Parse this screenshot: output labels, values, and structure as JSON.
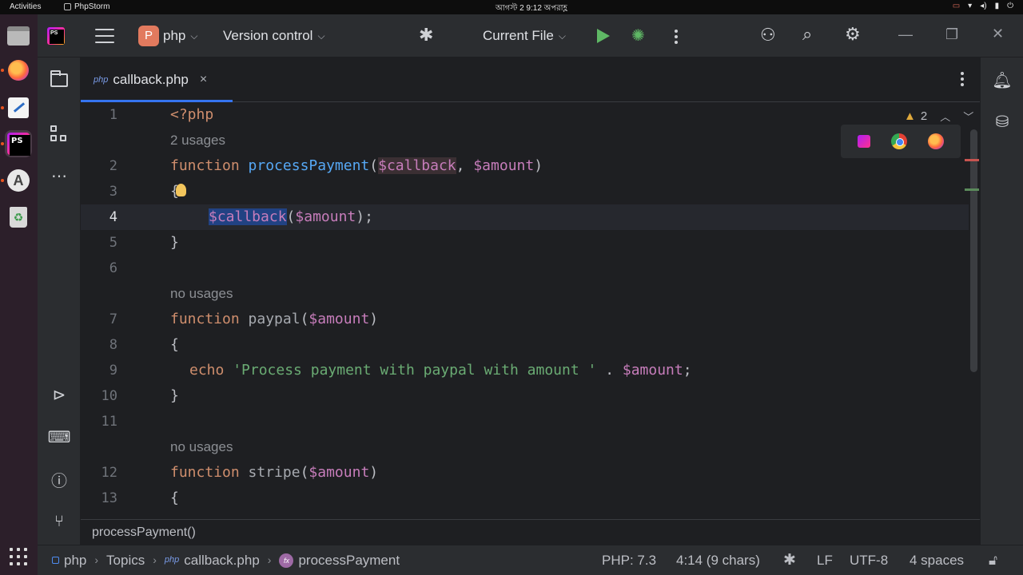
{
  "system_bar": {
    "activities": "Activities",
    "app_name": "PhpStorm",
    "clock": "আগস্ট 2  9:12 অপরাহ্ণ"
  },
  "toolbar": {
    "project_badge": "P",
    "project_name": "php",
    "vcs_label": "Version control",
    "run_config": "Current File"
  },
  "tabs": [
    {
      "lang_tag": "php",
      "label": "callback.php",
      "close": "×"
    }
  ],
  "editor": {
    "warnings_count": "2",
    "lines": [
      {
        "n": "1"
      },
      {
        "hint": "2 usages"
      },
      {
        "n": "2"
      },
      {
        "n": "3"
      },
      {
        "n": "4"
      },
      {
        "n": "5"
      },
      {
        "n": "6"
      },
      {
        "hint": "no usages"
      },
      {
        "n": "7"
      },
      {
        "n": "8"
      },
      {
        "n": "9"
      },
      {
        "n": "10"
      },
      {
        "n": "11"
      },
      {
        "hint": "no usages"
      },
      {
        "n": "12"
      },
      {
        "n": "13"
      }
    ],
    "code": {
      "l1": "<?php",
      "l2_kw": "function",
      "l2_fn": "processPayment",
      "l2_p1": "$callback",
      "l2_p2": "$amount",
      "l3": "{",
      "l4_sel": "$callback",
      "l4_arg": "$amount",
      "l5": "}",
      "l7_kw": "function",
      "l7_fn": "paypal",
      "l7_p": "$amount",
      "l8": "{",
      "l9_kw": "echo",
      "l9_str": "'Process payment with paypal with amount '",
      "l9_op": " . ",
      "l9_var": "$amount",
      "l10": "}",
      "l12_kw": "function",
      "l12_fn": "stripe",
      "l12_p": "$amount",
      "l13": "{"
    }
  },
  "breadcrumb_below": "processPayment()",
  "statusbar": {
    "module": "php",
    "topics": "Topics",
    "file_tag": "php",
    "file": "callback.php",
    "fn_badge": "fx",
    "function": "processPayment",
    "php_version": "PHP: 7.3",
    "caret": "4:14 (9 chars)",
    "line_sep": "LF",
    "encoding": "UTF-8",
    "indent": "4 spaces"
  },
  "colors": {
    "accent": "#3574f0",
    "keyword": "#cf8e6d",
    "function": "#56a8f5",
    "variable": "#c77dbb",
    "string": "#6aab73"
  },
  "icons": [
    "hamburger-icon",
    "debug-bug-icon",
    "run-icon",
    "debug-icon",
    "more-icon",
    "add-user-icon",
    "search-icon",
    "settings-icon",
    "minimize-icon",
    "restore-icon",
    "close-icon",
    "folder-icon",
    "structure-icon",
    "more-tools-icon",
    "services-icon",
    "terminal-icon",
    "problems-icon",
    "git-icon",
    "notifications-icon",
    "database-icon",
    "bulb-icon",
    "warning-icon",
    "lock-icon"
  ]
}
